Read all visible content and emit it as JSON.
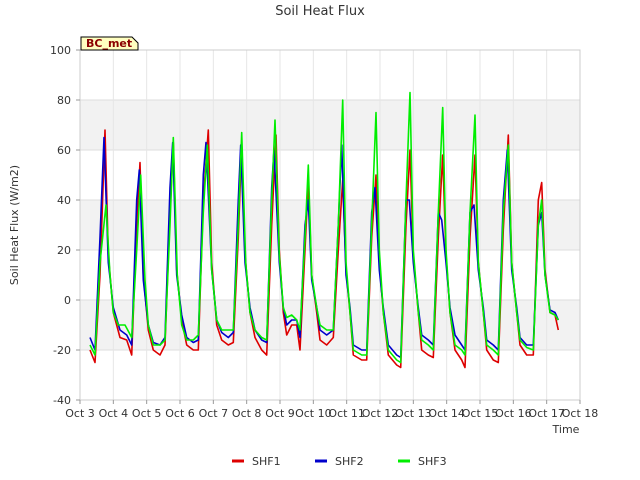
{
  "chart_data": {
    "type": "line",
    "title": "Soil Heat Flux",
    "badge": "BC_met",
    "xlabel": "Time",
    "ylabel": "Soil Heat Flux (W/m2)",
    "ylim": [
      -40,
      100
    ],
    "xlim": [
      0,
      15
    ],
    "x_ticks": [
      {
        "value": 0,
        "label": "Oct 3"
      },
      {
        "value": 1,
        "label": "Oct 4"
      },
      {
        "value": 2,
        "label": "Oct 5"
      },
      {
        "value": 3,
        "label": "Oct 6"
      },
      {
        "value": 4,
        "label": "Oct 7"
      },
      {
        "value": 5,
        "label": "Oct 8"
      },
      {
        "value": 6,
        "label": "Oct 9"
      },
      {
        "value": 7,
        "label": "Oct 10"
      },
      {
        "value": 8,
        "label": "Oct 11"
      },
      {
        "value": 9,
        "label": "Oct 12"
      },
      {
        "value": 10,
        "label": "Oct 13"
      },
      {
        "value": 11,
        "label": "Oct 14"
      },
      {
        "value": 12,
        "label": "Oct 15"
      },
      {
        "value": 13,
        "label": "Oct 16"
      },
      {
        "value": 14,
        "label": "Oct 17"
      },
      {
        "value": 15,
        "label": "Oct 18"
      }
    ],
    "y_ticks": [
      -40,
      -20,
      0,
      20,
      40,
      60,
      80,
      100
    ],
    "grid": true,
    "legend_position": "bottom-center",
    "series": [
      {
        "name": "SHF1",
        "color": "#dd0000",
        "points": [
          [
            0.3,
            -20
          ],
          [
            0.45,
            -25
          ],
          [
            0.6,
            10
          ],
          [
            0.75,
            68
          ],
          [
            0.85,
            18
          ],
          [
            1.0,
            -5
          ],
          [
            1.2,
            -15
          ],
          [
            1.4,
            -16
          ],
          [
            1.55,
            -22
          ],
          [
            1.7,
            30
          ],
          [
            1.8,
            55
          ],
          [
            1.9,
            10
          ],
          [
            2.05,
            -12
          ],
          [
            2.2,
            -20
          ],
          [
            2.4,
            -22
          ],
          [
            2.55,
            -18
          ],
          [
            2.7,
            35
          ],
          [
            2.8,
            63
          ],
          [
            2.9,
            12
          ],
          [
            3.05,
            -8
          ],
          [
            3.2,
            -18
          ],
          [
            3.4,
            -20
          ],
          [
            3.55,
            -20
          ],
          [
            3.7,
            40
          ],
          [
            3.85,
            68
          ],
          [
            3.95,
            15
          ],
          [
            4.1,
            -10
          ],
          [
            4.25,
            -16
          ],
          [
            4.45,
            -18
          ],
          [
            4.6,
            -17
          ],
          [
            4.75,
            25
          ],
          [
            4.85,
            62
          ],
          [
            4.95,
            18
          ],
          [
            5.1,
            -5
          ],
          [
            5.25,
            -15
          ],
          [
            5.45,
            -20
          ],
          [
            5.6,
            -22
          ],
          [
            5.75,
            30
          ],
          [
            5.88,
            66
          ],
          [
            5.98,
            20
          ],
          [
            6.1,
            -5
          ],
          [
            6.2,
            -14
          ],
          [
            6.35,
            -10
          ],
          [
            6.5,
            -10
          ],
          [
            6.6,
            -20
          ],
          [
            6.75,
            20
          ],
          [
            6.85,
            48
          ],
          [
            6.95,
            10
          ],
          [
            7.1,
            -5
          ],
          [
            7.2,
            -16
          ],
          [
            7.4,
            -18
          ],
          [
            7.6,
            -15
          ],
          [
            7.75,
            20
          ],
          [
            7.88,
            48
          ],
          [
            7.98,
            12
          ],
          [
            8.1,
            -5
          ],
          [
            8.2,
            -22
          ],
          [
            8.45,
            -24
          ],
          [
            8.6,
            -24
          ],
          [
            8.75,
            25
          ],
          [
            8.88,
            50
          ],
          [
            8.98,
            15
          ],
          [
            9.1,
            -5
          ],
          [
            9.25,
            -22
          ],
          [
            9.5,
            -26
          ],
          [
            9.62,
            -27
          ],
          [
            9.78,
            30
          ],
          [
            9.9,
            60
          ],
          [
            10.0,
            18
          ],
          [
            10.15,
            -5
          ],
          [
            10.25,
            -20
          ],
          [
            10.45,
            -22
          ],
          [
            10.6,
            -23
          ],
          [
            10.75,
            25
          ],
          [
            10.88,
            58
          ],
          [
            10.98,
            18
          ],
          [
            11.1,
            -5
          ],
          [
            11.25,
            -20
          ],
          [
            11.45,
            -24
          ],
          [
            11.55,
            -27
          ],
          [
            11.7,
            25
          ],
          [
            11.85,
            58
          ],
          [
            11.95,
            15
          ],
          [
            12.1,
            -5
          ],
          [
            12.2,
            -20
          ],
          [
            12.4,
            -24
          ],
          [
            12.55,
            -25
          ],
          [
            12.7,
            28
          ],
          [
            12.85,
            66
          ],
          [
            12.95,
            15
          ],
          [
            13.1,
            -5
          ],
          [
            13.2,
            -18
          ],
          [
            13.4,
            -22
          ],
          [
            13.6,
            -22
          ],
          [
            13.75,
            40
          ],
          [
            13.85,
            47
          ],
          [
            13.95,
            12
          ],
          [
            14.1,
            -5
          ],
          [
            14.25,
            -6
          ],
          [
            14.35,
            -12
          ]
        ]
      },
      {
        "name": "SHF2",
        "color": "#0000cc",
        "points": [
          [
            0.3,
            -15
          ],
          [
            0.45,
            -20
          ],
          [
            0.6,
            25
          ],
          [
            0.72,
            65
          ],
          [
            0.85,
            15
          ],
          [
            1.0,
            -3
          ],
          [
            1.2,
            -12
          ],
          [
            1.4,
            -14
          ],
          [
            1.55,
            -18
          ],
          [
            1.7,
            40
          ],
          [
            1.78,
            52
          ],
          [
            1.9,
            8
          ],
          [
            2.05,
            -10
          ],
          [
            2.2,
            -17
          ],
          [
            2.4,
            -18
          ],
          [
            2.55,
            -15
          ],
          [
            2.7,
            45
          ],
          [
            2.78,
            63
          ],
          [
            2.9,
            10
          ],
          [
            3.05,
            -6
          ],
          [
            3.2,
            -15
          ],
          [
            3.4,
            -17
          ],
          [
            3.55,
            -16
          ],
          [
            3.7,
            50
          ],
          [
            3.78,
            63
          ],
          [
            3.95,
            12
          ],
          [
            4.1,
            -8
          ],
          [
            4.25,
            -13
          ],
          [
            4.45,
            -15
          ],
          [
            4.6,
            -13
          ],
          [
            4.75,
            40
          ],
          [
            4.82,
            62
          ],
          [
            4.95,
            15
          ],
          [
            5.1,
            -3
          ],
          [
            5.25,
            -12
          ],
          [
            5.45,
            -16
          ],
          [
            5.6,
            -17
          ],
          [
            5.75,
            45
          ],
          [
            5.82,
            60
          ],
          [
            5.98,
            15
          ],
          [
            6.1,
            -3
          ],
          [
            6.2,
            -10
          ],
          [
            6.35,
            -8
          ],
          [
            6.5,
            -8
          ],
          [
            6.6,
            -15
          ],
          [
            6.75,
            30
          ],
          [
            6.85,
            40
          ],
          [
            6.95,
            8
          ],
          [
            7.1,
            -3
          ],
          [
            7.2,
            -12
          ],
          [
            7.4,
            -14
          ],
          [
            7.6,
            -12
          ],
          [
            7.75,
            30
          ],
          [
            7.85,
            62
          ],
          [
            7.98,
            10
          ],
          [
            8.1,
            -3
          ],
          [
            8.2,
            -18
          ],
          [
            8.45,
            -20
          ],
          [
            8.6,
            -20
          ],
          [
            8.75,
            35
          ],
          [
            8.85,
            45
          ],
          [
            8.98,
            12
          ],
          [
            9.1,
            -3
          ],
          [
            9.25,
            -18
          ],
          [
            9.5,
            -22
          ],
          [
            9.62,
            -23
          ],
          [
            9.78,
            40
          ],
          [
            9.88,
            40
          ],
          [
            10.0,
            15
          ],
          [
            10.15,
            -3
          ],
          [
            10.25,
            -14
          ],
          [
            10.45,
            -16
          ],
          [
            10.6,
            -18
          ],
          [
            10.75,
            35
          ],
          [
            10.85,
            32
          ],
          [
            10.98,
            15
          ],
          [
            11.1,
            -3
          ],
          [
            11.25,
            -14
          ],
          [
            11.45,
            -18
          ],
          [
            11.55,
            -20
          ],
          [
            11.7,
            35
          ],
          [
            11.82,
            38
          ],
          [
            11.95,
            12
          ],
          [
            12.1,
            -3
          ],
          [
            12.2,
            -16
          ],
          [
            12.4,
            -18
          ],
          [
            12.55,
            -20
          ],
          [
            12.7,
            40
          ],
          [
            12.82,
            60
          ],
          [
            12.95,
            12
          ],
          [
            13.1,
            -3
          ],
          [
            13.2,
            -15
          ],
          [
            13.4,
            -18
          ],
          [
            13.6,
            -18
          ],
          [
            13.75,
            30
          ],
          [
            13.85,
            35
          ],
          [
            13.95,
            10
          ],
          [
            14.1,
            -4
          ],
          [
            14.25,
            -5
          ],
          [
            14.35,
            -8
          ]
        ]
      },
      {
        "name": "SHF3",
        "color": "#00ee00",
        "points": [
          [
            0.3,
            -18
          ],
          [
            0.45,
            -22
          ],
          [
            0.6,
            15
          ],
          [
            0.78,
            38
          ],
          [
            0.9,
            10
          ],
          [
            1.0,
            -5
          ],
          [
            1.15,
            -10
          ],
          [
            1.35,
            -10
          ],
          [
            1.55,
            -15
          ],
          [
            1.7,
            20
          ],
          [
            1.82,
            50
          ],
          [
            1.95,
            8
          ],
          [
            2.05,
            -10
          ],
          [
            2.2,
            -18
          ],
          [
            2.4,
            -18
          ],
          [
            2.55,
            -16
          ],
          [
            2.7,
            30
          ],
          [
            2.8,
            65
          ],
          [
            2.92,
            10
          ],
          [
            3.05,
            -10
          ],
          [
            3.2,
            -16
          ],
          [
            3.4,
            -16
          ],
          [
            3.55,
            -14
          ],
          [
            3.7,
            35
          ],
          [
            3.82,
            62
          ],
          [
            3.95,
            12
          ],
          [
            4.1,
            -8
          ],
          [
            4.25,
            -12
          ],
          [
            4.45,
            -12
          ],
          [
            4.6,
            -12
          ],
          [
            4.75,
            30
          ],
          [
            4.85,
            67
          ],
          [
            4.97,
            15
          ],
          [
            5.1,
            -5
          ],
          [
            5.25,
            -12
          ],
          [
            5.45,
            -15
          ],
          [
            5.6,
            -16
          ],
          [
            5.75,
            40
          ],
          [
            5.85,
            72
          ],
          [
            5.98,
            18
          ],
          [
            6.1,
            -3
          ],
          [
            6.2,
            -7
          ],
          [
            6.35,
            -6
          ],
          [
            6.5,
            -8
          ],
          [
            6.6,
            -12
          ],
          [
            6.75,
            25
          ],
          [
            6.85,
            54
          ],
          [
            6.95,
            10
          ],
          [
            7.1,
            -3
          ],
          [
            7.2,
            -10
          ],
          [
            7.4,
            -12
          ],
          [
            7.6,
            -12
          ],
          [
            7.75,
            30
          ],
          [
            7.88,
            80
          ],
          [
            7.98,
            15
          ],
          [
            8.1,
            -5
          ],
          [
            8.2,
            -20
          ],
          [
            8.45,
            -22
          ],
          [
            8.6,
            -22
          ],
          [
            8.75,
            30
          ],
          [
            8.88,
            75
          ],
          [
            8.98,
            20
          ],
          [
            9.1,
            -5
          ],
          [
            9.25,
            -20
          ],
          [
            9.5,
            -24
          ],
          [
            9.62,
            -25
          ],
          [
            9.78,
            40
          ],
          [
            9.9,
            83
          ],
          [
            10.0,
            20
          ],
          [
            10.15,
            -5
          ],
          [
            10.25,
            -16
          ],
          [
            10.45,
            -18
          ],
          [
            10.6,
            -20
          ],
          [
            10.75,
            35
          ],
          [
            10.88,
            77
          ],
          [
            10.98,
            20
          ],
          [
            11.1,
            -5
          ],
          [
            11.25,
            -18
          ],
          [
            11.45,
            -20
          ],
          [
            11.55,
            -22
          ],
          [
            11.7,
            35
          ],
          [
            11.85,
            74
          ],
          [
            11.95,
            15
          ],
          [
            12.1,
            -5
          ],
          [
            12.2,
            -18
          ],
          [
            12.4,
            -20
          ],
          [
            12.55,
            -22
          ],
          [
            12.7,
            35
          ],
          [
            12.85,
            62
          ],
          [
            12.95,
            15
          ],
          [
            13.1,
            -5
          ],
          [
            13.2,
            -16
          ],
          [
            13.4,
            -19
          ],
          [
            13.6,
            -20
          ],
          [
            13.75,
            30
          ],
          [
            13.85,
            40
          ],
          [
            13.95,
            10
          ],
          [
            14.1,
            -5
          ],
          [
            14.25,
            -6
          ],
          [
            14.35,
            -8
          ]
        ]
      }
    ]
  }
}
